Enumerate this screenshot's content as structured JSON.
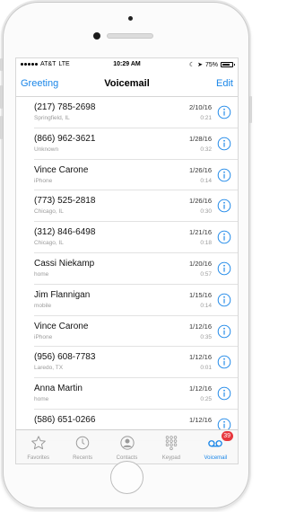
{
  "status_bar": {
    "carrier": "AT&T",
    "network": "LTE",
    "time": "10:29 AM",
    "battery": "75%",
    "battery_level": 0.75
  },
  "nav": {
    "left": "Greeting",
    "title": "Voicemail",
    "right": "Edit"
  },
  "voicemails": [
    {
      "name": "(217) 785-2698",
      "sub": "Springfield, IL",
      "date": "2/10/16",
      "duration": "0:21"
    },
    {
      "name": "(866) 962-3621",
      "sub": "Unknown",
      "date": "1/28/16",
      "duration": "0:32"
    },
    {
      "name": "Vince Carone",
      "sub": "iPhone",
      "date": "1/26/16",
      "duration": "0:14"
    },
    {
      "name": "(773) 525-2818",
      "sub": "Chicago, IL",
      "date": "1/26/16",
      "duration": "0:30"
    },
    {
      "name": "(312) 846-6498",
      "sub": "Chicago, IL",
      "date": "1/21/16",
      "duration": "0:18"
    },
    {
      "name": "Cassi Niekamp",
      "sub": "home",
      "date": "1/20/16",
      "duration": "0:57"
    },
    {
      "name": "Jim Flannigan",
      "sub": "mobile",
      "date": "1/15/16",
      "duration": "0:14"
    },
    {
      "name": "Vince Carone",
      "sub": "iPhone",
      "date": "1/12/16",
      "duration": "0:35"
    },
    {
      "name": "(956) 608-7783",
      "sub": "Laredo, TX",
      "date": "1/12/16",
      "duration": "0:01"
    },
    {
      "name": "Anna Martin",
      "sub": "home",
      "date": "1/12/16",
      "duration": "0:25"
    },
    {
      "name": "(586) 651-0266",
      "sub": "",
      "date": "1/12/16",
      "duration": ""
    }
  ],
  "tabs": {
    "favorites": "Favorites",
    "recents": "Recents",
    "contacts": "Contacts",
    "keypad": "Keypad",
    "voicemail": "Voicemail",
    "voicemail_badge": "39"
  },
  "colors": {
    "accent": "#1a86e8",
    "badge": "#e7363c"
  }
}
